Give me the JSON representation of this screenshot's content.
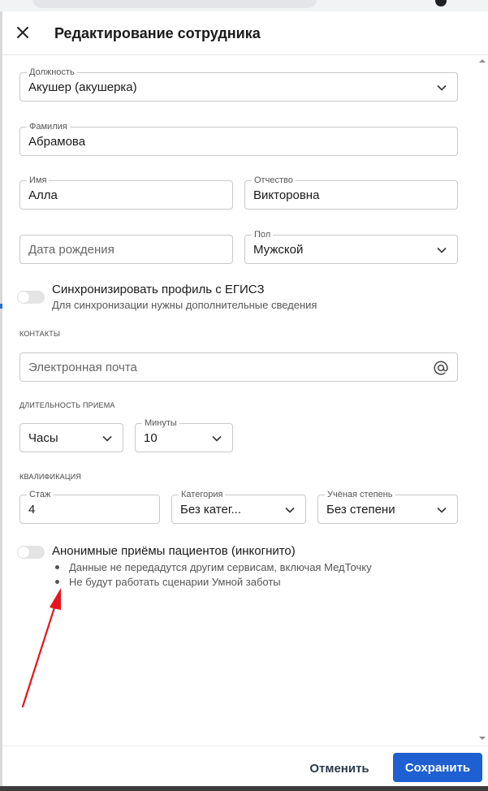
{
  "dialog": {
    "title": "Редактирование сотрудника"
  },
  "fields": {
    "position": {
      "label": "Должность",
      "value": "Акушер (акушерка)"
    },
    "last_name": {
      "label": "Фамилия",
      "value": "Абрамова"
    },
    "first_name": {
      "label": "Имя",
      "value": "Алла"
    },
    "patronymic": {
      "label": "Отчество",
      "value": "Викторовна"
    },
    "birth_date": {
      "placeholder": "Дата рождения"
    },
    "gender": {
      "label": "Пол",
      "value": "Мужской"
    }
  },
  "sync": {
    "title": "Синхронизировать профиль с ЕГИСЗ",
    "subtitle": "Для синхронизации нужны дополнительные сведения",
    "enabled": false
  },
  "contacts": {
    "section_label": "КОНТАКТЫ",
    "email_placeholder": "Электронная почта"
  },
  "duration": {
    "section_label": "ДЛИТЕЛЬНОСТЬ ПРИЕМА",
    "hours": {
      "value": "Часы"
    },
    "minutes": {
      "label": "Минуты",
      "value": "10"
    }
  },
  "qualification": {
    "section_label": "КВАЛИФИКАЦИЯ",
    "experience": {
      "label": "Стаж",
      "value": "4"
    },
    "category": {
      "label": "Категория",
      "value": "Без катег..."
    },
    "degree": {
      "label": "Учёная степень",
      "value": "Без степени"
    }
  },
  "anonymous": {
    "title": "Анонимные приёмы пациентов (инкогнито)",
    "enabled": false,
    "notes": [
      "Данные не передадутся другим сервисам, включая МедТочку",
      "Не будут работать сценарии Умной заботы"
    ]
  },
  "footer": {
    "cancel_label": "Отменить",
    "save_label": "Сохранить"
  },
  "colors": {
    "primary": "#1e5fd1",
    "annotation_arrow": "#e8141b",
    "toggle_off": "#e4e4e4"
  },
  "icons": {
    "close": "close-icon",
    "dropdown": "chevron-down-icon",
    "email": "at-sign-icon"
  }
}
